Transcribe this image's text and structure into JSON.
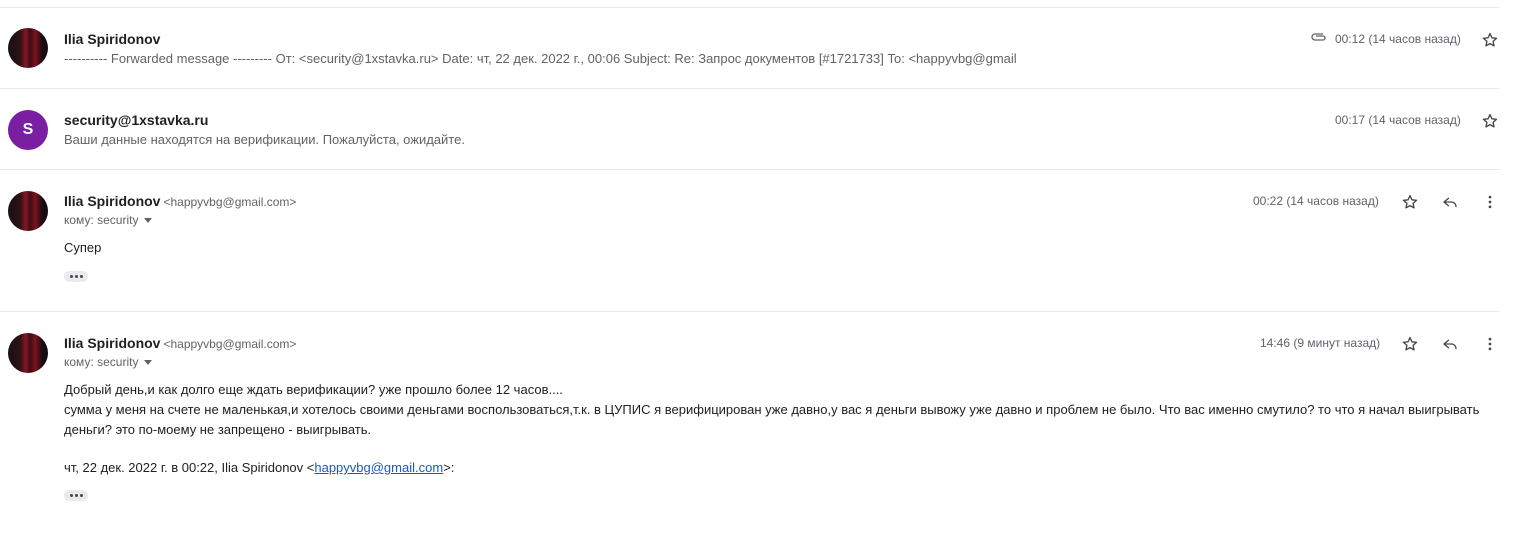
{
  "messages": [
    {
      "sender": "Ilia Spiridonov",
      "snippet": "---------- Forwarded message --------- От: <security@1xstavka.ru> Date: чт, 22 дек. 2022 г., 00:06 Subject: Re: Запрос документов [#1721733] To: <happyvbg@gmail",
      "time": "00:12 (14 часов назад)",
      "has_attachment": true
    },
    {
      "sender": "security@1xstavka.ru",
      "avatar_letter": "S",
      "avatar_color": "#7b1fa2",
      "snippet": "Ваши данные находятся на верификации. Пожалуйста, ожидайте.",
      "time": "00:17 (14 часов назад)"
    },
    {
      "sender": "Ilia Spiridonov",
      "email": "<happyvbg@gmail.com>",
      "to": "кому: security",
      "time": "00:22 (14 часов назад)",
      "body": "Супер"
    },
    {
      "sender": "Ilia Spiridonov",
      "email": "<happyvbg@gmail.com>",
      "to": "кому: security",
      "time": "14:46 (9 минут назад)",
      "body_line1": "Добрый день,и как долго еще ждать верификации? уже прошло более 12 часов....",
      "body_line2": "сумма у меня на счете не маленькая,и хотелось своими деньгами воспользоваться,т.к. в ЦУПИС я верифицирован уже давно,у вас я деньги вывожу уже давно и проблем не было. Что вас именно смутило? то что я начал выигрывать деньги? это по-моему не запрещено - выигрывать.",
      "quote_prefix": "чт, 22 дек. 2022 г. в 00:22, Ilia Spiridonov <",
      "quote_link": "happyvbg@gmail.com",
      "quote_suffix": ">:"
    }
  ],
  "icons": {
    "star": "star-outline-icon",
    "reply": "reply-icon",
    "more": "more-vert-icon",
    "attachment": "paperclip-icon"
  }
}
